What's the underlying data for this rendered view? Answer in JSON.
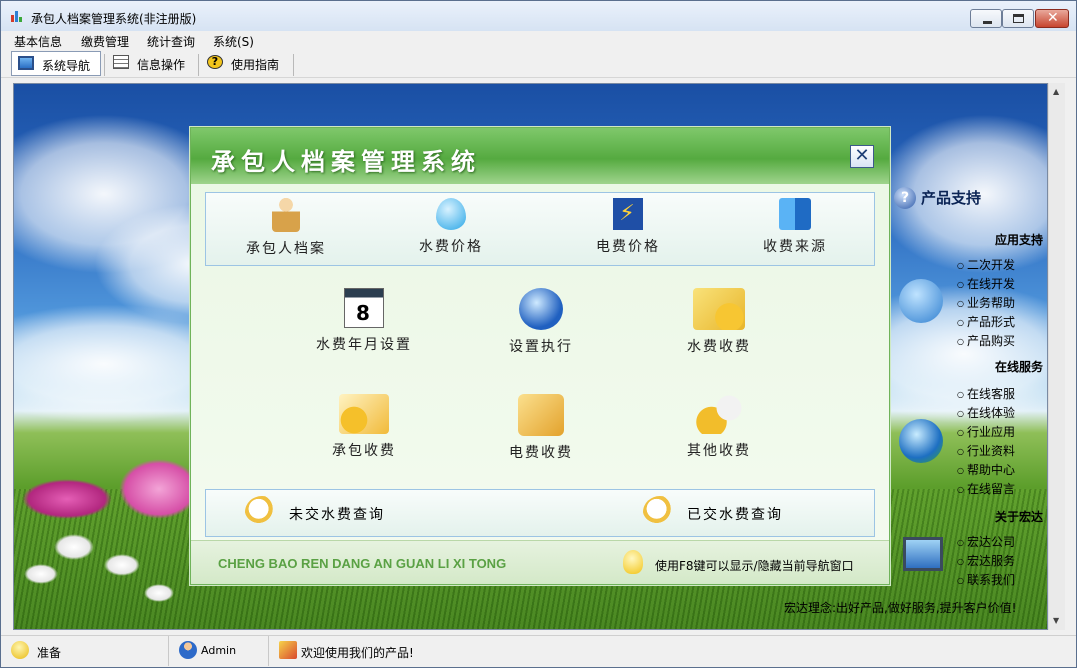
{
  "window": {
    "title": "承包人档案管理系统(非注册版)",
    "minimize_label": "–",
    "maximize_label": "□",
    "close_label": "✕"
  },
  "menu": [
    "基本信息",
    "缴费管理",
    "统计查询",
    "系统(S)"
  ],
  "toolbar": [
    {
      "label": "系统导航",
      "active": true,
      "icon": "monitor-icon"
    },
    {
      "label": "信息操作",
      "active": false,
      "icon": "grid-icon"
    },
    {
      "label": "使用指南",
      "active": false,
      "icon": "help-icon"
    }
  ],
  "nav": {
    "title": "承包人档案管理系统",
    "close_label": "✕",
    "top_items": [
      {
        "label": "承包人档案",
        "icon": "person-icon"
      },
      {
        "label": "水费价格",
        "icon": "water-drop-icon"
      },
      {
        "label": "电费价格",
        "icon": "lightning-icon"
      },
      {
        "label": "收费来源",
        "icon": "finder-icon"
      }
    ],
    "middle_items": [
      {
        "label": "水费年月设置",
        "icon": "calendar-icon"
      },
      {
        "label": "设置执行",
        "icon": "globe-icon"
      },
      {
        "label": "水费收费",
        "icon": "coins-icon"
      },
      {
        "label": "承包收费",
        "icon": "coins-card-icon"
      },
      {
        "label": "电费收费",
        "icon": "cash-register-icon"
      },
      {
        "label": "其他收费",
        "icon": "money-bag-icon"
      }
    ],
    "queries": [
      {
        "label": "未交水费查询",
        "icon": "magnifier-icon"
      },
      {
        "label": "已交水费查询",
        "icon": "magnifier-icon"
      }
    ],
    "footer_pinyin": "CHENG BAO REN DANG AN GUAN LI XI TONG",
    "footer_hint": "使用F8键可以显示/隐藏当前导航窗口"
  },
  "support": {
    "header": "产品支持",
    "sections": [
      {
        "title": "应用支持",
        "links": [
          "二次开发",
          "在线开发",
          "业务帮助",
          "产品形式",
          "产品购买"
        ]
      },
      {
        "title": "在线服务",
        "links": [
          "在线客服",
          "在线体验",
          "行业应用",
          "行业资料",
          "帮助中心",
          "在线留言"
        ]
      },
      {
        "title": "关于宏达",
        "links": [
          "宏达公司",
          "宏达服务",
          "联系我们"
        ]
      }
    ],
    "slogan": "宏达理念:出好产品,做好服务,提升客户价值!"
  },
  "status": {
    "ready": "准备",
    "user": "Admin",
    "welcome": "欢迎使用我们的产品!"
  },
  "colors": {
    "nav_green": "#55aa40",
    "pinyin_green": "#5aa144",
    "title_blue": "#0b2455"
  }
}
